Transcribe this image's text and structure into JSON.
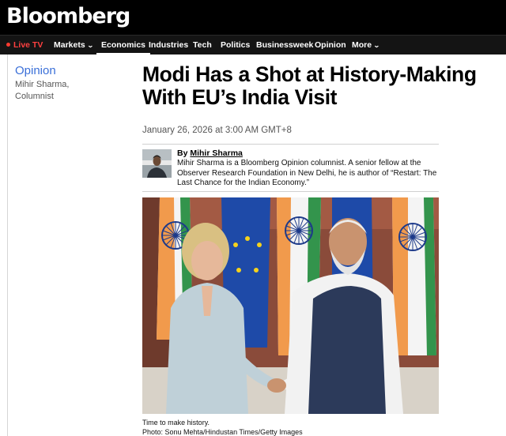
{
  "brand": {
    "logo": "Bloomberg"
  },
  "nav": {
    "live_tv": "Live TV",
    "markets": "Markets",
    "economics": "Economics",
    "industries": "Industries",
    "tech": "Tech",
    "politics": "Politics",
    "businessweek": "Businessweek",
    "opinion": "Opinion",
    "more": "More"
  },
  "sidebar": {
    "section": "Opinion",
    "author_line1": "Mihir Sharma,",
    "author_line2": "Columnist"
  },
  "article": {
    "headline": "Modi Has a Shot at History-Making With EU’s India Visit",
    "date": "January 26, 2026 at 3:00 AM GMT+8",
    "by_label": "By",
    "author": "Mihir Sharma",
    "bio": "Mihir Sharma is a Bloomberg Opinion columnist. A senior fellow at the Observer Research Foundation in New Delhi, he is author of “Restart: The Last Chance for the Indian Economy.”",
    "caption_line1": "Time to make history.",
    "caption_line2": "Photo: Sonu Mehta/Hindustan Times/Getty Images"
  },
  "colors": {
    "accent_blue": "#3a6fd8",
    "live_red": "#ff3b30",
    "nav_bg": "#141414"
  }
}
